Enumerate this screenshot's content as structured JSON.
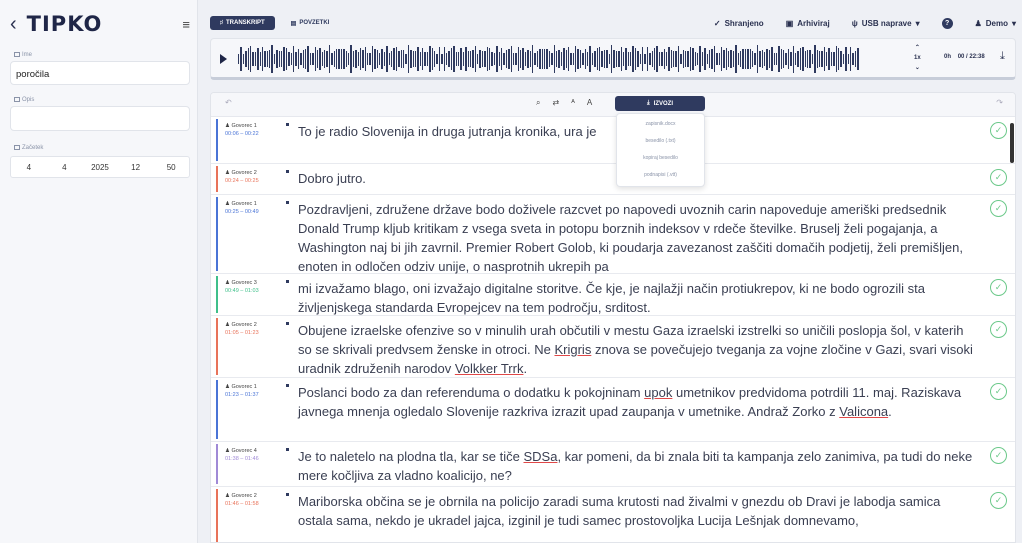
{
  "sidebar": {
    "logo": "TIPKO",
    "name_label": "Ime",
    "name_value": "poročila",
    "desc_label": "Opis",
    "desc_value": "",
    "start_label": "Začetek",
    "start": [
      "4",
      "4",
      "2025",
      "12",
      "50"
    ]
  },
  "topbar": {
    "tab_transcript": "TRANSKRIPT",
    "tab_summary": "POVZETKI",
    "saved": "Shranjeno",
    "archive": "Arhiviraj",
    "usb": "USB naprave",
    "user": "Demo"
  },
  "player": {
    "speed": "1x",
    "time_prefix": "0h",
    "time": "00 / 22:38"
  },
  "export": {
    "button": "IZVOZI",
    "options": [
      "zapisnik.docx",
      "besedilo (.txt)",
      "kopiraj besedilo",
      "podnapisi (.vtt)"
    ]
  },
  "colors": {
    "accent": "#2f3a5f",
    "check": "#6cc98a",
    "speaker1": "#4a74d6",
    "speaker2": "#e8735a",
    "speaker3": "#3fbf8a",
    "speaker4": "#a08ad6"
  },
  "segments": [
    {
      "speaker": "Govorec 1",
      "time": "00:06 – 00:22",
      "text": "To je radio Slovenija in druga jutranja kronika, ura je"
    },
    {
      "speaker": "Govorec 2",
      "time": "00:24 – 00:25",
      "text": "Dobro jutro."
    },
    {
      "speaker": "Govorec 1",
      "time": "00:25 – 00:49",
      "text": "Pozdravljeni, združene države bodo doživele razcvet po napovedi uvoznih carin napoveduje ameriški predsednik Donald Trump kljub kritikam z vsega sveta in potopu borznih indeksov v rdeče številke. Bruselj želi pogajanja, a Washington naj bi jih zavrnil. Premier Robert Golob, ki poudarja zavezanost zaščiti domačih podjetij, želi premišljen, enoten in odločen odziv unije, o nasprotnih ukrepih pa"
    },
    {
      "speaker": "Govorec 3",
      "time": "00:49 – 01:03",
      "text": "mi izvažamo blago, oni izvažajo digitalne storitve. Če kje, je najlažji način protiukrepov, ki ne bodo ogrozili sta življenjskega standarda Evropejcev na tem področju, srditost."
    },
    {
      "speaker": "Govorec 2",
      "time": "01:05 – 01:23",
      "text": "Obujene izraelske ofenzive so v minulih urah občutili v mestu Gaza izraelski izstrelki so uničili poslopja šol, v katerih so se skrivali predvsem ženske in otroci. Ne Krigris znova se povečujejo tveganja za vojne zločine v Gazi, svari visoki uradnik združenih narodov Volkker Trrk."
    },
    {
      "speaker": "Govorec 1",
      "time": "01:23 – 01:37",
      "text": "Poslanci bodo za dan referenduma o dodatku k pokojninam upok umetnikov predvidoma potrdili 11. maj. Raziskava javnega mnenja ogledalo Slovenije razkriva izrazit upad zaupanja v umetnike. Andraž Zorko z Valicona."
    },
    {
      "speaker": "Govorec 4",
      "time": "01:38 – 01:46",
      "text": "Je to naletelo na plodna tla, kar se tiče SDSa, kar pomeni, da bi znala biti ta kampanja zelo zanimiva, pa tudi do neke mere kočljiva za vladno koalicijo, ne?"
    },
    {
      "speaker": "Govorec 2",
      "time": "01:46 – 01:58",
      "text": "Mariborska občina se je obrnila na policijo zaradi suma krutosti nad živalmi v gnezdu ob Dravi je labodja samica ostala sama, nekdo je ukradel jajca, izginil je tudi samec prostovoljka Lucija Lešnjak domnevamo,"
    }
  ]
}
